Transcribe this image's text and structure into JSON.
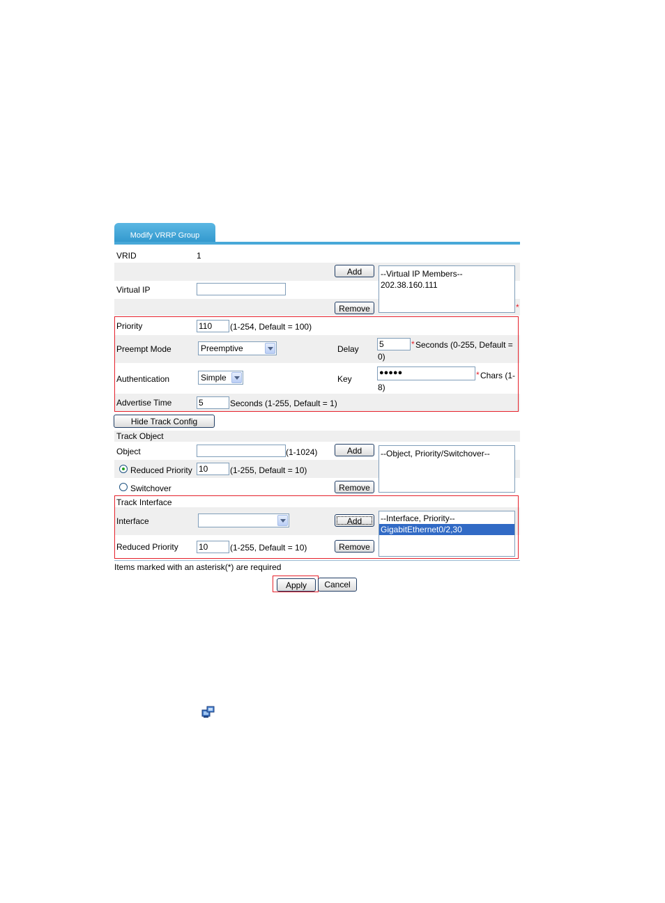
{
  "tab": {
    "label": "Modify VRRP Group"
  },
  "vrid": {
    "label": "VRID",
    "value": "1"
  },
  "virtual_ip": {
    "label": "Virtual IP",
    "input_value": "",
    "add_label": "Add",
    "remove_label": "Remove",
    "members_header": "--Virtual IP Members--",
    "members": [
      "202.38.160.111"
    ],
    "required_mark": "*"
  },
  "priority": {
    "label": "Priority",
    "value": "110",
    "hint": "(1-254, Default = 100)"
  },
  "preempt": {
    "label": "Preempt Mode",
    "selected": "Preemptive",
    "delay_label": "Delay",
    "delay_value": "5",
    "delay_req": "*",
    "delay_hint_1": "Seconds (0-255, Default =",
    "delay_hint_2": "0)"
  },
  "auth": {
    "label": "Authentication",
    "selected": "Simple",
    "key_label": "Key",
    "key_value": "●●●●●",
    "key_req": "*",
    "key_hint_1": "Chars (1-",
    "key_hint_2": "8)"
  },
  "advertise": {
    "label": "Advertise Time",
    "value": "5",
    "hint": "Seconds (1-255, Default = 1)"
  },
  "hide_track_label": "Hide Track Config",
  "track_object": {
    "section_label": "Track Object",
    "object_label": "Object",
    "object_value": "",
    "object_hint": "(1-1024)",
    "add_label": "Add",
    "remove_label": "Remove",
    "reduced_label": "Reduced Priority",
    "reduced_value": "10",
    "reduced_hint": "(1-255, Default = 10)",
    "switchover_label": "Switchover",
    "list_header": "--Object, Priority/Switchover--"
  },
  "track_interface": {
    "section_label": "Track Interface",
    "interface_label": "Interface",
    "interface_selected": "",
    "add_label": "Add",
    "remove_label": "Remove",
    "reduced_label": "Reduced Priority",
    "reduced_value": "10",
    "reduced_hint": "(1-255, Default = 10)",
    "list_header": "--Interface, Priority--",
    "list_items": [
      "GigabitEthernet0/2,30"
    ]
  },
  "footer_note": "Items marked with an asterisk(*) are required",
  "apply_label": "Apply",
  "cancel_label": "Cancel",
  "colors": {
    "accent": "#48a8d8",
    "highlight": "#e5202a",
    "selection": "#316ac5"
  }
}
